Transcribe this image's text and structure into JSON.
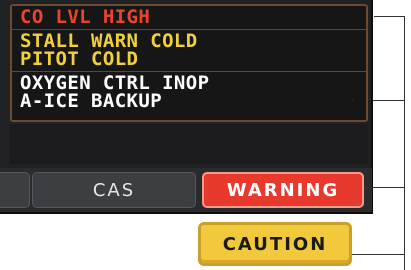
{
  "cas_messages": {
    "warning": [
      {
        "text": "CO LVL HIGH"
      }
    ],
    "caution": [
      {
        "text": "STALL WARN COLD"
      },
      {
        "text": "PITOT COLD"
      }
    ],
    "advisory": [
      {
        "text": "OXYGEN CTRL INOP"
      },
      {
        "text": "A-ICE BACKUP"
      }
    ]
  },
  "softkeys": {
    "cas": "CAS",
    "warning": "WARNING"
  },
  "caution_button": "CAUTION",
  "colors": {
    "warning_text": "#e8442e",
    "caution_text": "#f0d03c",
    "advisory_text": "#ffffff",
    "warning_key": "#e83a2c",
    "caution_key": "#f2c83c"
  }
}
